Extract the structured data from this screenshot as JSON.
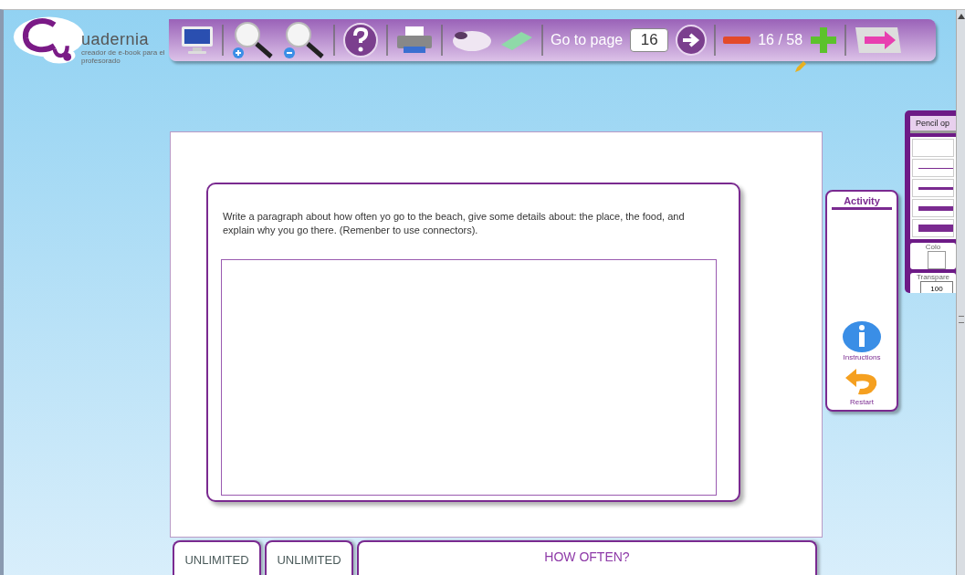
{
  "logo": {
    "name": "uadernia",
    "tagline": "creador de e-book para el profesorado"
  },
  "toolbar": {
    "goto_label": "Go to page",
    "page_input": "16",
    "page_count": "16 / 58"
  },
  "activity": {
    "prompt": "Write a paragraph about how often yo go to the beach, give some details about: the place, the food, and explain why you go there. (Remenber to use connectors)."
  },
  "bottom_tabs": [
    {
      "label": "UNLIMITED",
      "kind": "counter"
    },
    {
      "label": "UNLIMITED",
      "kind": "counter"
    },
    {
      "label": "HOW OFTEN?",
      "kind": "title"
    }
  ],
  "side_panel": {
    "title": "Activity",
    "buttons": [
      {
        "label": "Instructions",
        "kind": "info"
      },
      {
        "label": "Restart",
        "kind": "restart"
      }
    ]
  },
  "pencil_panel": {
    "title": "Pencil op",
    "color_label": "Colo",
    "transparency_label": "Transpare",
    "transparency_value": "100"
  }
}
